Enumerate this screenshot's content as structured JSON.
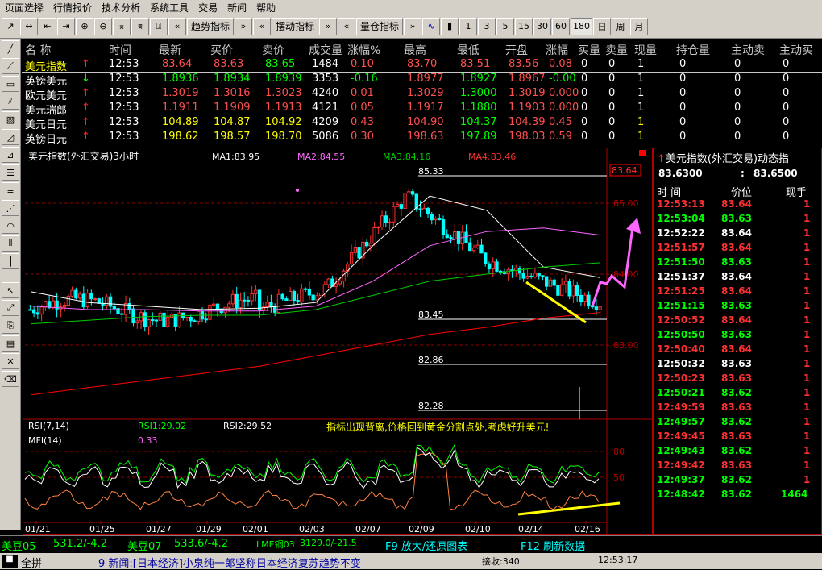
{
  "menu": [
    "页面选择",
    "行情报价",
    "技术分析",
    "系统工具",
    "交易",
    "新闻",
    "帮助"
  ],
  "toolbar": {
    "trend_label": "趋势指标",
    "swing_label": "摆动指标",
    "volume_label": "量仓指标",
    "periods": [
      "1",
      "3",
      "5",
      "15",
      "30",
      "60",
      "180",
      "日",
      "周",
      "月"
    ],
    "selected_period": "180"
  },
  "quote_table": {
    "headers": [
      "名  称",
      "时间",
      "最新",
      "买价",
      "卖价",
      "成交量",
      "涨幅%",
      "最高",
      "最低",
      "开盘",
      "涨幅",
      "买量",
      "卖量",
      "现量",
      "持仓量",
      "主动卖",
      "主动买"
    ],
    "rows": [
      {
        "name": "美元指数",
        "dir": "up",
        "time": "12:53",
        "last": "83.64",
        "bid": "83.63",
        "ask": "83.65",
        "vol": "1484",
        "chg_pct": "0.10",
        "high": "83.70",
        "low": "83.51",
        "open": "83.56",
        "chg": "0.08",
        "bidq": "0",
        "askq": "0",
        "curq": "1",
        "oi": "0",
        "asell": "0",
        "abuy": "0"
      },
      {
        "name": "英镑美元",
        "dir": "down",
        "time": "12:53",
        "last": "1.8936",
        "bid": "1.8934",
        "ask": "1.8939",
        "vol": "3353",
        "chg_pct": "-0.16",
        "high": "1.8977",
        "low": "1.8927",
        "open": "1.8967",
        "chg": "-0.00",
        "bidq": "0",
        "askq": "0",
        "curq": "1",
        "oi": "0",
        "asell": "0",
        "abuy": "0"
      },
      {
        "name": "欧元美元",
        "dir": "up",
        "time": "12:53",
        "last": "1.3019",
        "bid": "1.3016",
        "ask": "1.3023",
        "vol": "4240",
        "chg_pct": "0.01",
        "high": "1.3029",
        "low": "1.3000",
        "open": "1.3019",
        "chg": "0.000",
        "bidq": "0",
        "askq": "0",
        "curq": "1",
        "oi": "0",
        "asell": "0",
        "abuy": "0"
      },
      {
        "name": "美元瑞郎",
        "dir": "up",
        "time": "12:53",
        "last": "1.1911",
        "bid": "1.1909",
        "ask": "1.1913",
        "vol": "4121",
        "chg_pct": "0.05",
        "high": "1.1917",
        "low": "1.1880",
        "open": "1.1903",
        "chg": "0.000",
        "bidq": "0",
        "askq": "0",
        "curq": "1",
        "oi": "0",
        "asell": "0",
        "abuy": "0"
      },
      {
        "name": "美元日元",
        "dir": "up",
        "time": "12:53",
        "last": "104.89",
        "bid": "104.87",
        "ask": "104.92",
        "vol": "4209",
        "chg_pct": "0.43",
        "high": "104.90",
        "low": "104.37",
        "open": "104.39",
        "chg": "0.45",
        "bidq": "0",
        "askq": "0",
        "curq": "1",
        "oi": "0",
        "asell": "0",
        "abuy": "0"
      },
      {
        "name": "英镑日元",
        "dir": "up",
        "time": "12:53",
        "last": "198.62",
        "bid": "198.57",
        "ask": "198.70",
        "vol": "5086",
        "chg_pct": "0.30",
        "high": "198.63",
        "low": "197.89",
        "open": "198.03",
        "chg": "0.59",
        "bidq": "0",
        "askq": "0",
        "curq": "1",
        "oi": "0",
        "asell": "0",
        "abuy": "0"
      }
    ]
  },
  "chart": {
    "title": "美元指数(外汇交易)3小时",
    "ma1": "MA1:83.95",
    "ma2": "MA2:84.55",
    "ma3": "MA3:84.16",
    "ma4": "MA4:83.46",
    "price_tag": "83.64",
    "yaxis": [
      "85.00",
      "84.00",
      "83.00"
    ],
    "fib_labels": [
      "85.33",
      "83.45",
      "82.86",
      "82.28"
    ],
    "rsi_label": "RSI(7,14)",
    "rsi1": "RSI1:29.02",
    "rsi2": "RSI2:29.52",
    "mfi_label": "MFI(14)",
    "mfi_val": "0.33",
    "annotation": "指标出现背离,价格回到黄金分割点处,考虑好升美元!",
    "osc_axis": [
      "80",
      "50"
    ],
    "dates": [
      "01/21",
      "01/25",
      "01/27",
      "01/29",
      "02/01",
      "02/03",
      "02/07",
      "02/09",
      "02/10",
      "02/14",
      "02/16"
    ],
    "colors": {
      "up": "#ff3030",
      "down": "#00ffff",
      "ma1": "#ffffff",
      "ma2": "#ff66ff",
      "ma3": "#00cc00",
      "ma4": "#ff0000",
      "annot": "#ffff00"
    }
  },
  "chart_data": {
    "type": "line",
    "title": "美元指数(外汇交易)3小时",
    "ylim": [
      82.0,
      85.5
    ],
    "x": [
      "01/21",
      "01/25",
      "01/27",
      "01/29",
      "02/01",
      "02/03",
      "02/07",
      "02/09",
      "02/10",
      "02/14",
      "02/16"
    ],
    "series": [
      {
        "name": "MA1",
        "values": [
          83.75,
          83.6,
          83.55,
          83.5,
          83.52,
          83.6,
          84.4,
          85.1,
          84.9,
          84.1,
          83.95
        ]
      },
      {
        "name": "MA2",
        "values": [
          83.55,
          83.5,
          83.5,
          83.48,
          83.48,
          83.55,
          83.9,
          84.4,
          84.6,
          84.65,
          84.55
        ]
      },
      {
        "name": "MA3",
        "values": [
          83.3,
          83.35,
          83.4,
          83.42,
          83.42,
          83.5,
          83.7,
          83.9,
          84.0,
          84.1,
          84.16
        ]
      },
      {
        "name": "MA4",
        "values": [
          82.3,
          82.4,
          82.5,
          82.6,
          82.7,
          82.85,
          83.0,
          83.15,
          83.25,
          83.38,
          83.46
        ]
      }
    ]
  },
  "ticks": {
    "title": "美元指数(外汇交易)动态指",
    "bid": "83.6300",
    "ask": "83.6500",
    "headers": [
      "时 间",
      "价位",
      "现手"
    ],
    "rows": [
      {
        "t": "12:53:13",
        "p": "83.64",
        "v": "1",
        "c": "red"
      },
      {
        "t": "12:53:04",
        "p": "83.63",
        "v": "1",
        "c": "green"
      },
      {
        "t": "12:52:22",
        "p": "83.64",
        "v": "1",
        "c": "white"
      },
      {
        "t": "12:51:57",
        "p": "83.64",
        "v": "1",
        "c": "red"
      },
      {
        "t": "12:51:50",
        "p": "83.63",
        "v": "1",
        "c": "green"
      },
      {
        "t": "12:51:37",
        "p": "83.64",
        "v": "1",
        "c": "white"
      },
      {
        "t": "12:51:25",
        "p": "83.64",
        "v": "1",
        "c": "red"
      },
      {
        "t": "12:51:15",
        "p": "83.63",
        "v": "1",
        "c": "green"
      },
      {
        "t": "12:50:52",
        "p": "83.64",
        "v": "1",
        "c": "red"
      },
      {
        "t": "12:50:50",
        "p": "83.63",
        "v": "1",
        "c": "green"
      },
      {
        "t": "12:50:40",
        "p": "83.64",
        "v": "1",
        "c": "red"
      },
      {
        "t": "12:50:32",
        "p": "83.63",
        "v": "1",
        "c": "white"
      },
      {
        "t": "12:50:23",
        "p": "83.63",
        "v": "1",
        "c": "red"
      },
      {
        "t": "12:50:21",
        "p": "83.62",
        "v": "1",
        "c": "green"
      },
      {
        "t": "12:49:59",
        "p": "83.63",
        "v": "1",
        "c": "red"
      },
      {
        "t": "12:49:57",
        "p": "83.62",
        "v": "1",
        "c": "green"
      },
      {
        "t": "12:49:45",
        "p": "83.63",
        "v": "1",
        "c": "red"
      },
      {
        "t": "12:49:43",
        "p": "83.62",
        "v": "1",
        "c": "green"
      },
      {
        "t": "12:49:42",
        "p": "83.63",
        "v": "1",
        "c": "red"
      },
      {
        "t": "12:49:37",
        "p": "83.62",
        "v": "1",
        "c": "green"
      },
      {
        "t": "12:48:42",
        "p": "83.62",
        "v": "1464",
        "c": "green"
      }
    ]
  },
  "statusbar": {
    "items": [
      {
        "label": "美豆05",
        "value": "531.2/-4.2"
      },
      {
        "label": "美豆07",
        "value": "533.6/-4.2"
      },
      {
        "label": "LME铜03",
        "value": "3129.0/-21.5"
      }
    ],
    "f9": "F9 放大/还原图表",
    "f12": "F12 刷新数据",
    "full_label": "全拼",
    "news": "9 新闻:[日本经济]小泉纯一郎坚称日本经济复苏趋势不变",
    "recv": "接收:340",
    "clock": "12:53:17"
  }
}
